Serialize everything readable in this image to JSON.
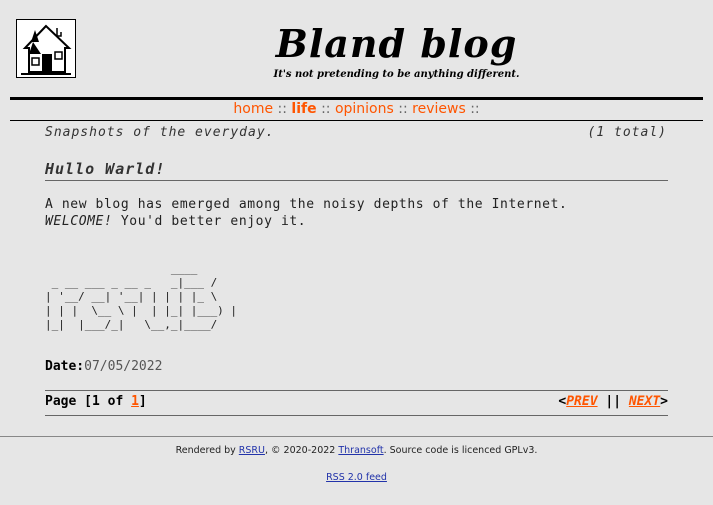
{
  "site": {
    "title": "Bland blog",
    "tagline": "It's not pretending to be anything different."
  },
  "nav": {
    "items": [
      {
        "label": "home"
      },
      {
        "label": "life"
      },
      {
        "label": "opinions"
      },
      {
        "label": "reviews"
      }
    ],
    "separator": "::",
    "active": "life",
    "accent_color": "#ff5500"
  },
  "category": {
    "description": "Snapshots of the everyday.",
    "total": "(1 total)"
  },
  "post": {
    "title": "Hullo Warld!",
    "line1": "A new blog has emerged among the noisy depths of the Internet.",
    "line2_em": "WELCOME!",
    "line2_rest": " You'd better enjoy it.",
    "ascii_art": "                   ____\n _ __ ___ _ __ _   _|___ /\n| '__/ __| '__| | | | |_ \\\n| | |  \\__ \\ |  | |_| |___) |\n|_|  |___/_|   \\__,_|____/",
    "date_label": "Date:",
    "date_value": "07/05/2022"
  },
  "pager": {
    "page_prefix": "Page [1 of ",
    "current_page": "1",
    "page_suffix": "]",
    "lt": "<",
    "prev": "PREV",
    "divider": " || ",
    "next": "NEXT",
    "gt": ">"
  },
  "footer": {
    "rendered_by": "Rendered by ",
    "rsru": "RSRU",
    "copyright": ", © 2020-2022 ",
    "thransoft": "Thransoft",
    "licence": ". Source code is licenced GPLv3.",
    "rss": "RSS 2.0 feed"
  }
}
